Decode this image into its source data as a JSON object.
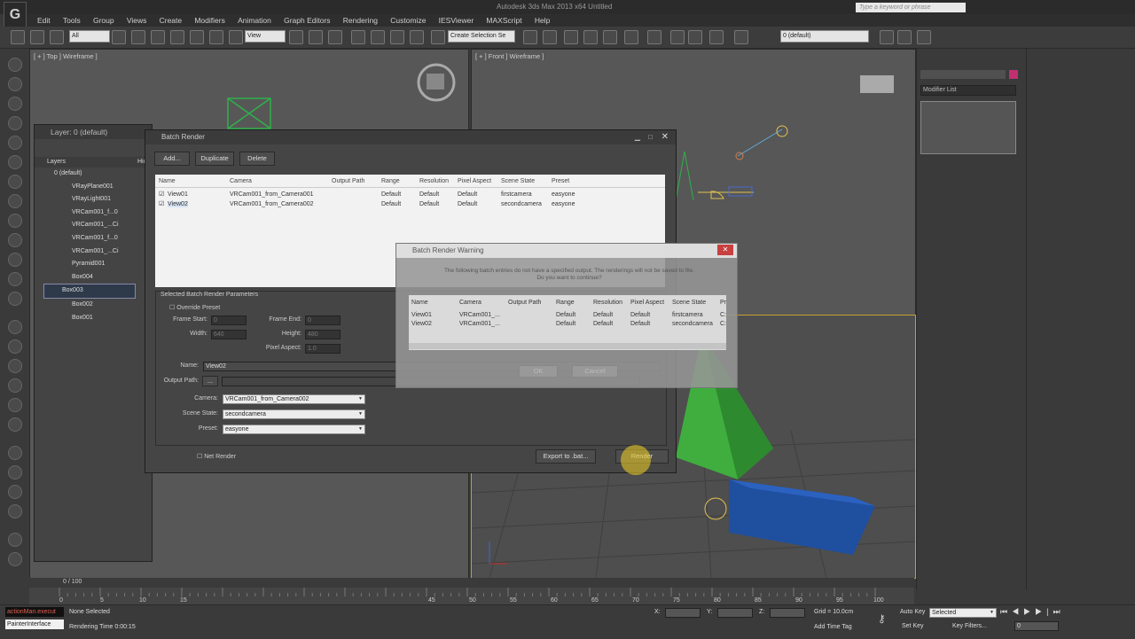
{
  "window": {
    "title": "Autodesk 3ds Max 2013 x64    Untitled",
    "logo": "G"
  },
  "search": {
    "placeholder": "Type a keyword or phrase"
  },
  "menu": [
    "Edit",
    "Tools",
    "Group",
    "Views",
    "Create",
    "Modifiers",
    "Animation",
    "Graph Editors",
    "Rendering",
    "Customize",
    "IESViewer",
    "MAXScript",
    "Help"
  ],
  "toolbar": {
    "filter": "All",
    "view": "View",
    "selection_set": "Create Selection Se",
    "layer": "0 (default)"
  },
  "viewports": {
    "top": "[ + ] Top ] Wireframe ]",
    "front": "[ + ] Front ] Wireframe ]"
  },
  "command_panel": {
    "modifier_list": "Modifier List"
  },
  "layer_dialog": {
    "title": "Layer: 0 (default)",
    "col_layers": "Layers",
    "col_hide": "Hid",
    "rows": [
      "0 (default)",
      "VRayPlane001",
      "VRayLight001",
      "VRCam001_f...0",
      "VRCam001_...Ci",
      "VRCam001_f...0",
      "VRCam001_...Ci",
      "Pyramid001",
      "Box004",
      "Box003",
      "Box002",
      "Box001"
    ]
  },
  "batch_render": {
    "title": "Batch Render",
    "buttons": {
      "add": "Add...",
      "duplicate": "Duplicate",
      "delete": "Delete",
      "export": "Export to .bat...",
      "render": "Render"
    },
    "columns": [
      "Name",
      "Camera",
      "Output Path",
      "Range",
      "Resolution",
      "Pixel Aspect",
      "Scene State",
      "Preset"
    ],
    "rows": [
      {
        "name": "View01",
        "camera": "VRCam001_from_Camera001",
        "range": "Default",
        "resolution": "Default",
        "aspect": "Default",
        "state": "firstcamera",
        "preset": "easyone",
        "checked": true
      },
      {
        "name": "View02",
        "camera": "VRCam001_from_Camera002",
        "range": "Default",
        "resolution": "Default",
        "aspect": "Default",
        "state": "secondcamera",
        "preset": "easyone",
        "checked": true
      }
    ],
    "params": {
      "group": "Selected Batch Render Parameters",
      "override": "Override Preset",
      "frame_start_label": "Frame Start:",
      "frame_start": "0",
      "frame_end_label": "Frame End:",
      "frame_end": "0",
      "width_label": "Width:",
      "width": "640",
      "height_label": "Height:",
      "height": "480",
      "aspect_label": "Pixel Aspect:",
      "aspect": "1.0",
      "name_label": "Name:",
      "name": "View02",
      "output_label": "Output Path:",
      "output_btn": "...",
      "camera_label": "Camera:",
      "camera": "VRCam001_from_Camera002",
      "state_label": "Scene State:",
      "state": "secondcamera",
      "preset_label": "Preset:",
      "preset": "easyone",
      "net_render": "Net Render"
    }
  },
  "warning": {
    "title": "Batch Render Warning",
    "message1": "The following batch entries do not have a specified output. The renderings will not be saved to file.",
    "message2": "Do you want to continue?",
    "columns": [
      "Name",
      "Camera",
      "Output Path",
      "Range",
      "Resolution",
      "Pixel Aspect",
      "Scene State",
      "Pr"
    ],
    "rows": [
      [
        "View01",
        "VRCam001_...",
        "",
        "Default",
        "Default",
        "Default",
        "firstcamera",
        "C:"
      ],
      [
        "View02",
        "VRCam001_...",
        "",
        "Default",
        "Default",
        "Default",
        "secondcamera",
        "C:"
      ]
    ],
    "ok": "OK",
    "cancel": "Cancel"
  },
  "timeline": {
    "frame": "0 / 100",
    "ticks": [
      "0",
      "5",
      "10",
      "15",
      "45",
      "50",
      "55",
      "60",
      "65",
      "70",
      "75",
      "80",
      "85",
      "90",
      "95",
      "100"
    ]
  },
  "status": {
    "maxscript": "actionMan.execut",
    "painter": "PainterInterface",
    "none_selected": "None Selected",
    "render_time": "Rendering Time 0:00:15",
    "x": "X:",
    "y": "Y:",
    "z": "Z:",
    "grid": "Grid = 10.0cm",
    "add_time_tag": "Add Time Tag",
    "auto_key": "Auto Key",
    "auto_key_value": "Selected",
    "set_key": "Set Key",
    "key_filters": "Key Filters...",
    "frame": "0"
  }
}
